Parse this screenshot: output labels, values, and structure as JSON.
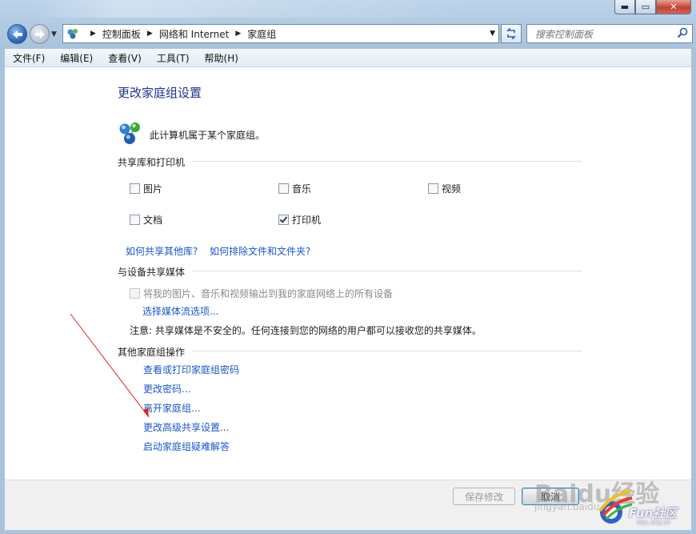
{
  "window": {
    "minimize_glyph": "▬",
    "maximize_glyph": "▭",
    "close_glyph": "✕"
  },
  "breadcrumb": [
    {
      "label": "控制面板"
    },
    {
      "label": "网络和 Internet"
    },
    {
      "label": "家庭组"
    }
  ],
  "search": {
    "placeholder": "搜索控制面板"
  },
  "menu": [
    {
      "label": "文件(F)"
    },
    {
      "label": "编辑(E)"
    },
    {
      "label": "查看(V)"
    },
    {
      "label": "工具(T)"
    },
    {
      "label": "帮助(H)"
    }
  ],
  "page": {
    "title": "更改家庭组设置",
    "status": "此计算机属于某个家庭组。"
  },
  "sharing": {
    "heading": "共享库和打印机",
    "items": [
      {
        "label": "图片",
        "checked": false
      },
      {
        "label": "音乐",
        "checked": false
      },
      {
        "label": "视频",
        "checked": false
      },
      {
        "label": "文档",
        "checked": false
      },
      {
        "label": "打印机",
        "checked": true
      }
    ],
    "link_share_other": "如何共享其他库?",
    "link_exclude": "如何排除文件和文件夹?"
  },
  "media": {
    "heading": "与设备共享媒体",
    "checkbox_label": "将我的图片、音乐和视频输出到我的家庭网络上的所有设备",
    "stream_link": "选择媒体流选项...",
    "note": "注意: 共享媒体是不安全的。任何连接到您的网络的用户都可以接收您的共享媒体。"
  },
  "other": {
    "heading": "其他家庭组操作",
    "links": [
      "查看或打印家庭组密码",
      "更改密码...",
      "离开家庭组...",
      "更改高级共享设置...",
      "启动家庭组疑难解答"
    ]
  },
  "buttons": {
    "save": "保存修改",
    "cancel": "取消"
  },
  "watermark": {
    "baidu": "Baidu经验",
    "sub": "jingyan.baidu.com",
    "community": "Fun社区",
    "url": "bbs.3ky.cn"
  },
  "colors": {
    "link": "#1a57c4",
    "title": "#1e3287",
    "annotation_arrow": "#e02020"
  }
}
